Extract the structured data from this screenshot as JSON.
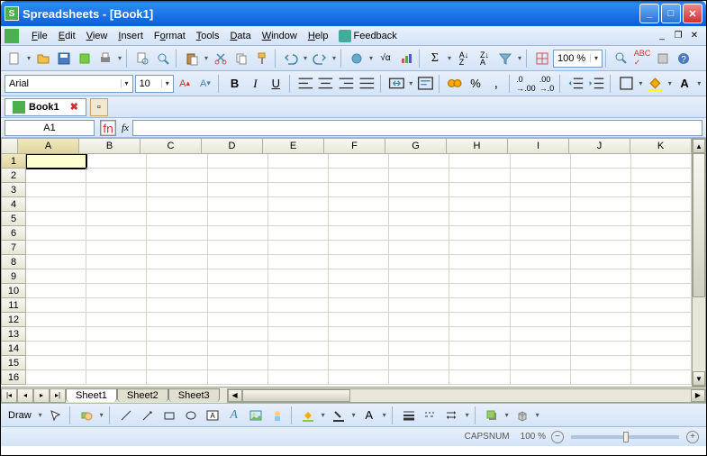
{
  "titlebar": {
    "title": "Spreadsheets - [Book1]"
  },
  "menu": {
    "items": [
      "File",
      "Edit",
      "View",
      "Insert",
      "Format",
      "Tools",
      "Data",
      "Window",
      "Help"
    ],
    "feedback": "Feedback"
  },
  "toolbar1": {
    "zoom": "100 %"
  },
  "formatbar": {
    "font": "Arial",
    "size": "10",
    "bold": "B",
    "italic": "I",
    "underline": "U",
    "incfont": "A",
    "decfont": "A"
  },
  "doctab": {
    "name": "Book1"
  },
  "refbar": {
    "cellref": "A1",
    "fx": "fx"
  },
  "grid": {
    "cols": [
      "A",
      "B",
      "C",
      "D",
      "E",
      "F",
      "G",
      "H",
      "I",
      "J",
      "K"
    ],
    "rows": [
      "1",
      "2",
      "3",
      "4",
      "5",
      "6",
      "7",
      "8",
      "9",
      "10",
      "11",
      "12",
      "13",
      "14",
      "15",
      "16"
    ],
    "selected": "A1"
  },
  "sheets": {
    "tabs": [
      "Sheet1",
      "Sheet2",
      "Sheet3"
    ],
    "active": 0
  },
  "drawbar": {
    "label": "Draw"
  },
  "statusbar": {
    "caps": "CAPSNUM",
    "zoom": "100 %",
    "minus": "−",
    "plus": "+"
  }
}
